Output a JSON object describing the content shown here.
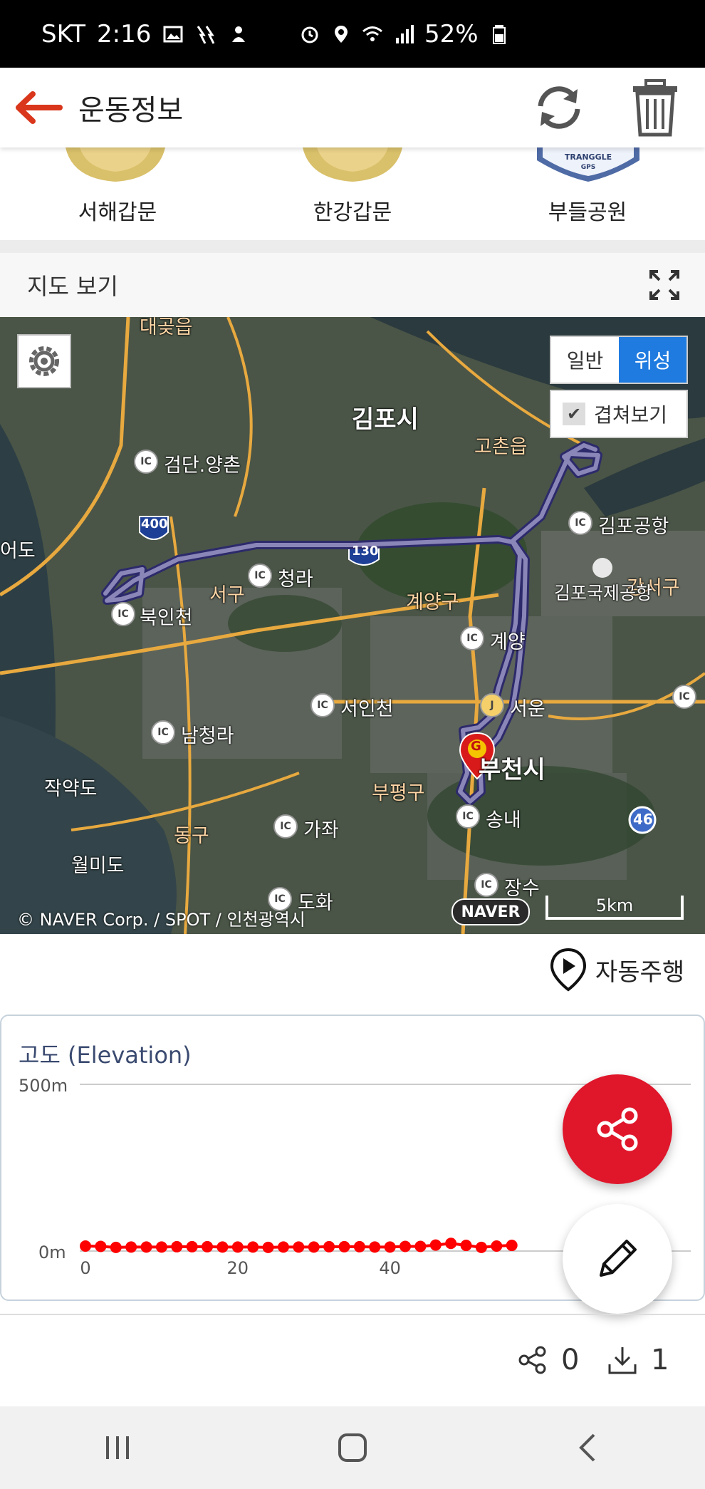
{
  "status_bar": {
    "carrier": "SKT",
    "time": "2:16",
    "battery": "52%"
  },
  "header": {
    "title": "운동정보"
  },
  "badges": [
    {
      "label": "서해갑문"
    },
    {
      "label": "한강갑문"
    },
    {
      "label": "부들공원",
      "badge_text": "TRANGGLE\nGPS"
    }
  ],
  "map_section": {
    "title": "지도 보기",
    "map_type_options": [
      "일반",
      "위성"
    ],
    "map_type_selected": "위성",
    "overlay_label": "겹쳐보기",
    "overlay_checked": true,
    "copyright": "© NAVER Corp. / SPOT / 인천광역시",
    "naver_logo": "NAVER",
    "scale_label": "5km",
    "places": {
      "gimpo_si": "김포시",
      "bucheon_si": "부천시",
      "geomdan": "검단.양촌",
      "cheongra": "청라",
      "bugincheon": "북인천",
      "seogu": "서구",
      "gyeyanggu": "계양구",
      "gyeyang": "계양",
      "seoincheon": "서인천",
      "seoun": "서운",
      "namcheongra": "남청라",
      "bupyeonggu": "부평구",
      "jakyakdo": "작약도",
      "donggu": "동구",
      "gajwa": "가좌",
      "wolmido": "월미도",
      "songnae": "송내",
      "jangsu": "장수",
      "dohwa": "도화",
      "gochon": "고촌읍",
      "gimpo_jc": "김포공항",
      "gimpo_airport": "김포국제공항",
      "gangseogu": "강서구",
      "yeongjong": "어도",
      "highway400": "400",
      "highway130": "130",
      "route46": "46",
      "marker": "G",
      "geomdan_top": "대곶읍"
    }
  },
  "auto_drive": {
    "label": "자동주행"
  },
  "elevation": {
    "title": "고도 (Elevation)"
  },
  "chart_data": {
    "type": "line",
    "title": "고도 (Elevation)",
    "xlabel": "",
    "ylabel": "",
    "yticks": [
      "500m",
      "0m"
    ],
    "xticks": [
      "0",
      "20",
      "40"
    ],
    "ylim": [
      0,
      500
    ],
    "xlim": [
      0,
      55
    ],
    "grid": true,
    "series": [
      {
        "color": "#ff0000",
        "x": [
          0,
          2,
          4,
          6,
          8,
          10,
          12,
          14,
          16,
          18,
          20,
          22,
          24,
          26,
          28,
          30,
          32,
          34,
          36,
          38,
          40,
          42,
          44,
          46,
          48,
          50,
          52,
          54,
          56
        ],
        "y": [
          15,
          14,
          11,
          12,
          12,
          12,
          13,
          13,
          13,
          12,
          12,
          12,
          11,
          12,
          12,
          12,
          13,
          13,
          13,
          12,
          12,
          14,
          14,
          18,
          23,
          17,
          11,
          15,
          17
        ]
      }
    ]
  },
  "stats": {
    "share_count": "0",
    "download_count": "1"
  },
  "colors": {
    "accent_red": "#e0162b",
    "map_selected_blue": "#1f7be0",
    "route_color": "#5a5a8c",
    "elevation_line": "#ff0000"
  }
}
